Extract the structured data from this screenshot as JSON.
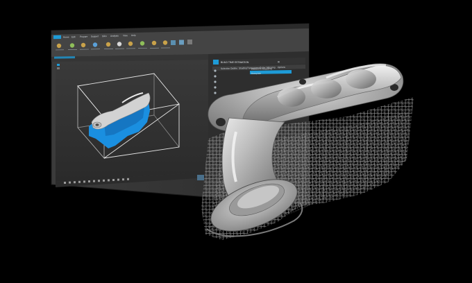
{
  "app": {
    "window_title": "",
    "ribbon_tabs": [
      "File",
      "Home",
      "Edit",
      "Prepare",
      "Support",
      "Slice",
      "Analysis",
      "View",
      "Help"
    ],
    "toolbar_buttons": [
      "",
      "",
      "",
      "",
      "",
      "",
      "",
      "",
      "",
      "",
      "",
      "",
      ""
    ],
    "panel": {
      "title": "BUILD TIME ESTIMATION",
      "tabs": [
        "Selection",
        "Outline",
        "Shading",
        "Transparency",
        "Cutter",
        "Mirroring",
        "Options"
      ],
      "list_items": [
        "Element 1 (Supports)",
        "Baseplate"
      ]
    },
    "accent_color": "#1e9bd7",
    "part_color": "#1a8fe0",
    "viewport_bg": "#2f2f2f",
    "chrome_color": "#3a3a3a"
  },
  "scene": {
    "background": "#000000",
    "part": "exhaust-manifold",
    "support_lattice": "lattice-supports"
  }
}
